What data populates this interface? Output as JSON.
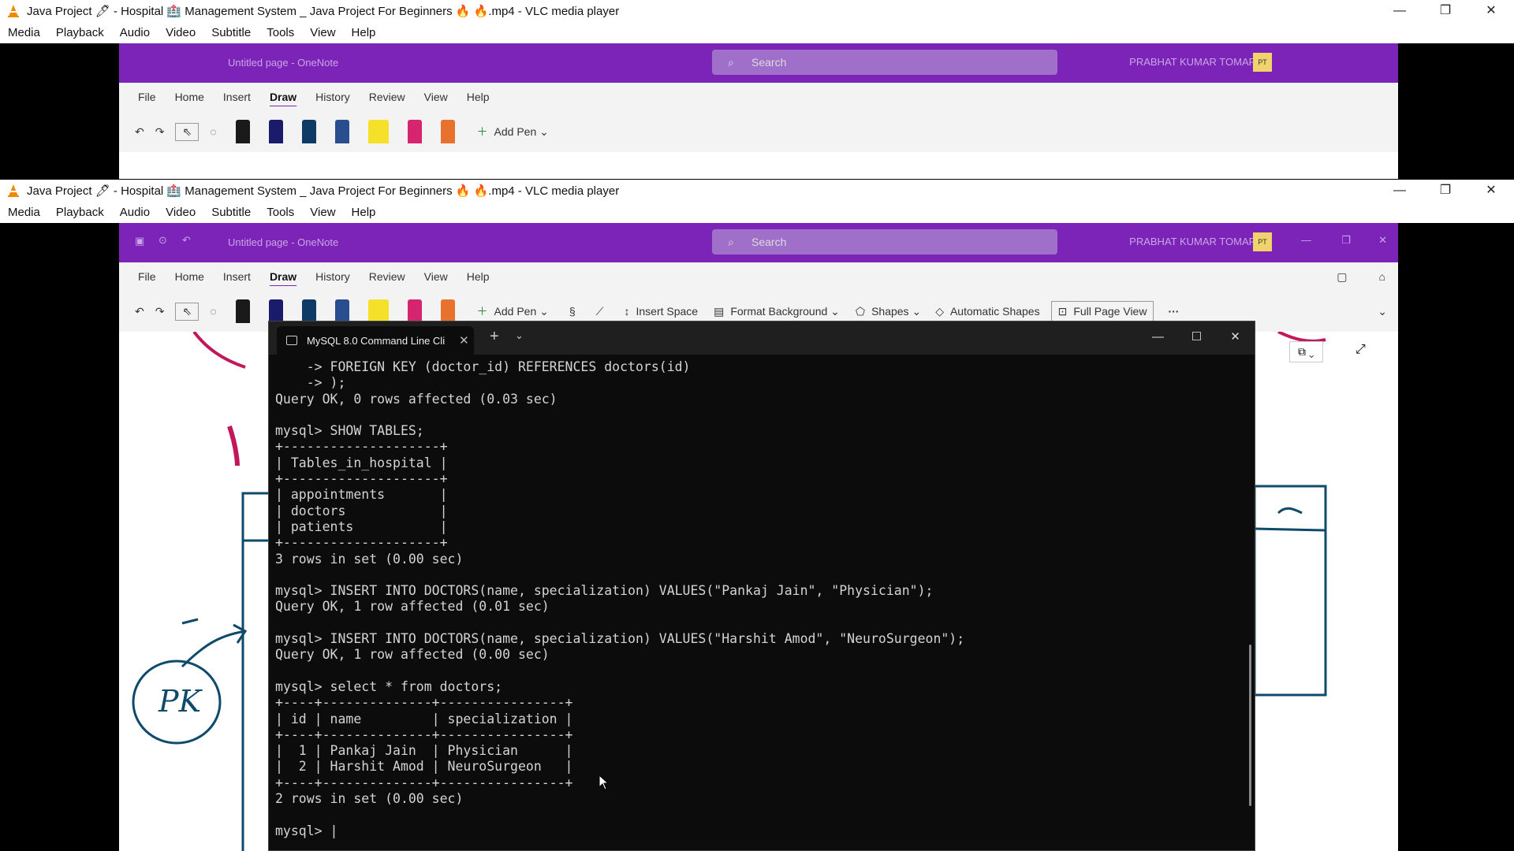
{
  "vlc": {
    "title": "Java Project 🖊 - Hospital 🏥 Management System _ Java Project For Beginners 🔥 🔥.mp4 - VLC media player",
    "menu": [
      "Media",
      "Playback",
      "Audio",
      "Video",
      "Subtitle",
      "Tools",
      "View",
      "Help"
    ],
    "window_buttons": [
      "—",
      "❐",
      "✕"
    ]
  },
  "onenote": {
    "title": "Untitled page - OneNote",
    "search_placeholder": "Search",
    "user_name": "PRABHAT KUMAR TOMAR",
    "user_initials": "PT",
    "tabs": [
      "File",
      "Home",
      "Insert",
      "Draw",
      "History",
      "Review",
      "View",
      "Help"
    ],
    "active_tab": "Draw",
    "toolbar": {
      "add_pen": "Add Pen",
      "insert_space": "Insert Space",
      "format_background": "Format Background",
      "shapes": "Shapes",
      "automatic_shapes": "Automatic Shapes",
      "full_page_view": "Full Page View"
    },
    "pen_colors": [
      "#1a1a1a",
      "#1b1b6b",
      "#0d3b66",
      "#2a4d8f",
      "#f5e02a",
      "#d6246e",
      "#e8712d"
    ],
    "accent": "#7b24b7"
  },
  "terminal": {
    "tab_title": "MySQL 8.0 Command Line Cli",
    "lines": [
      "    -> FOREIGN KEY (doctor_id) REFERENCES doctors(id)",
      "    -> );",
      "Query OK, 0 rows affected (0.03 sec)",
      "",
      "mysql> SHOW TABLES;",
      "+--------------------+",
      "| Tables_in_hospital |",
      "+--------------------+",
      "| appointments       |",
      "| doctors            |",
      "| patients           |",
      "+--------------------+",
      "3 rows in set (0.00 sec)",
      "",
      "mysql> INSERT INTO DOCTORS(name, specialization) VALUES(\"Pankaj Jain\", \"Physician\");",
      "Query OK, 1 row affected (0.01 sec)",
      "",
      "mysql> INSERT INTO DOCTORS(name, specialization) VALUES(\"Harshit Amod\", \"NeuroSurgeon\");",
      "Query OK, 1 row affected (0.00 sec)",
      "",
      "mysql> select * from doctors;",
      "+----+--------------+----------------+",
      "| id | name         | specialization |",
      "+----+--------------+----------------+",
      "|  1 | Pankaj Jain  | Physician      |",
      "|  2 | Harshit Amod | NeuroSurgeon   |",
      "+----+--------------+----------------+",
      "2 rows in set (0.00 sec)",
      "",
      "mysql> |"
    ]
  },
  "drawing_text": {
    "circle_label": "PK"
  }
}
